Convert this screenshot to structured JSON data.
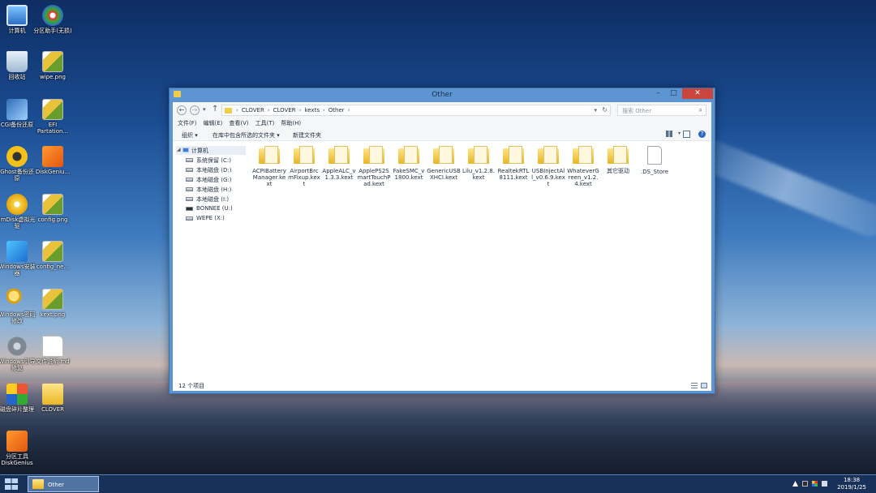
{
  "desktop": {
    "icons": [
      {
        "label": "计算机",
        "icon": "computer-icon"
      },
      {
        "label": "分区助手(无损)",
        "icon": "partition-assistant-icon"
      },
      {
        "label": "回收站",
        "icon": "recycle-bin-icon"
      },
      {
        "label": "wipe.png",
        "icon": "png-file-icon"
      },
      {
        "label": "CGI备份还原",
        "icon": "cgi-backup-icon"
      },
      {
        "label": "EFI Partation...",
        "icon": "png-file-icon"
      },
      {
        "label": "Ghost备份还原",
        "icon": "ghost-icon"
      },
      {
        "label": "DiskGeniu...",
        "icon": "diskgenius-icon"
      },
      {
        "label": "ImDisk虚拟光驱",
        "icon": "imdisk-icon"
      },
      {
        "label": "config.png",
        "icon": "png-file-icon"
      },
      {
        "label": "Windows安装器",
        "icon": "windows-installer-icon"
      },
      {
        "label": "config_ne...",
        "icon": "png-file-icon"
      },
      {
        "label": "Windows密码修改",
        "icon": "key-icon"
      },
      {
        "label": "kext.png",
        "icon": "png-file-icon"
      },
      {
        "label": "Windows引导修复",
        "icon": "gear-icon"
      },
      {
        "label": "文件说明.md",
        "icon": "text-file-icon"
      },
      {
        "label": "磁盘碎片整理",
        "icon": "defrag-icon"
      },
      {
        "label": "CLOVER",
        "icon": "folder-icon"
      },
      {
        "label": "分区工具 DiskGenius",
        "icon": "diskgenius-icon"
      }
    ]
  },
  "window": {
    "title": "Other",
    "address": {
      "crumbs": [
        "CLOVER",
        "CLOVER",
        "kexts",
        "Other"
      ],
      "separator": "›"
    },
    "search_placeholder": "搜索 Other",
    "menu": [
      "文件(F)",
      "编辑(E)",
      "查看(V)",
      "工具(T)",
      "帮助(H)"
    ],
    "commands": {
      "organize": "组织 ▾",
      "include_library": "在库中包含所选的文件夹 ▾",
      "new_folder": "新建文件夹"
    },
    "nav": {
      "computer": "计算机",
      "drives": [
        "系统保留 (C:)",
        "本地磁盘 (D:)",
        "本地磁盘 (G:)",
        "本地磁盘 (H:)",
        "本地磁盘 (I:)",
        "BONNEE (U:)",
        "WEPE (X:)"
      ]
    },
    "items": [
      {
        "name": "ACPIBatteryManager.kext",
        "type": "folder"
      },
      {
        "name": "AirportBrcmFixup.kext",
        "type": "folder"
      },
      {
        "name": "AppleALC_v1.3.3.kext",
        "type": "folder"
      },
      {
        "name": "ApplePS2SmartTouchPad.kext",
        "type": "folder"
      },
      {
        "name": "FakeSMC_v1800.kext",
        "type": "folder"
      },
      {
        "name": "GenericUSBXHCI.kext",
        "type": "folder"
      },
      {
        "name": "Lilu_v1.2.8.kext",
        "type": "folder"
      },
      {
        "name": "RealtekRTL8111.kext",
        "type": "folder"
      },
      {
        "name": "USBInjectAll_v0.6.9.kext",
        "type": "folder"
      },
      {
        "name": "WhateverGreen_v1.2.4.kext",
        "type": "folder"
      },
      {
        "name": "其它驱动",
        "type": "folder"
      },
      {
        "name": ".DS_Store",
        "type": "file"
      }
    ],
    "status": "12 个项目"
  },
  "taskbar": {
    "task_label": "Other",
    "time": "18:38",
    "date": "2019/1/25"
  },
  "colors": {
    "window_frame": "#5d94d2",
    "close_button": "#c9453d",
    "taskbar": "#18325c",
    "folder": "#eab424"
  }
}
